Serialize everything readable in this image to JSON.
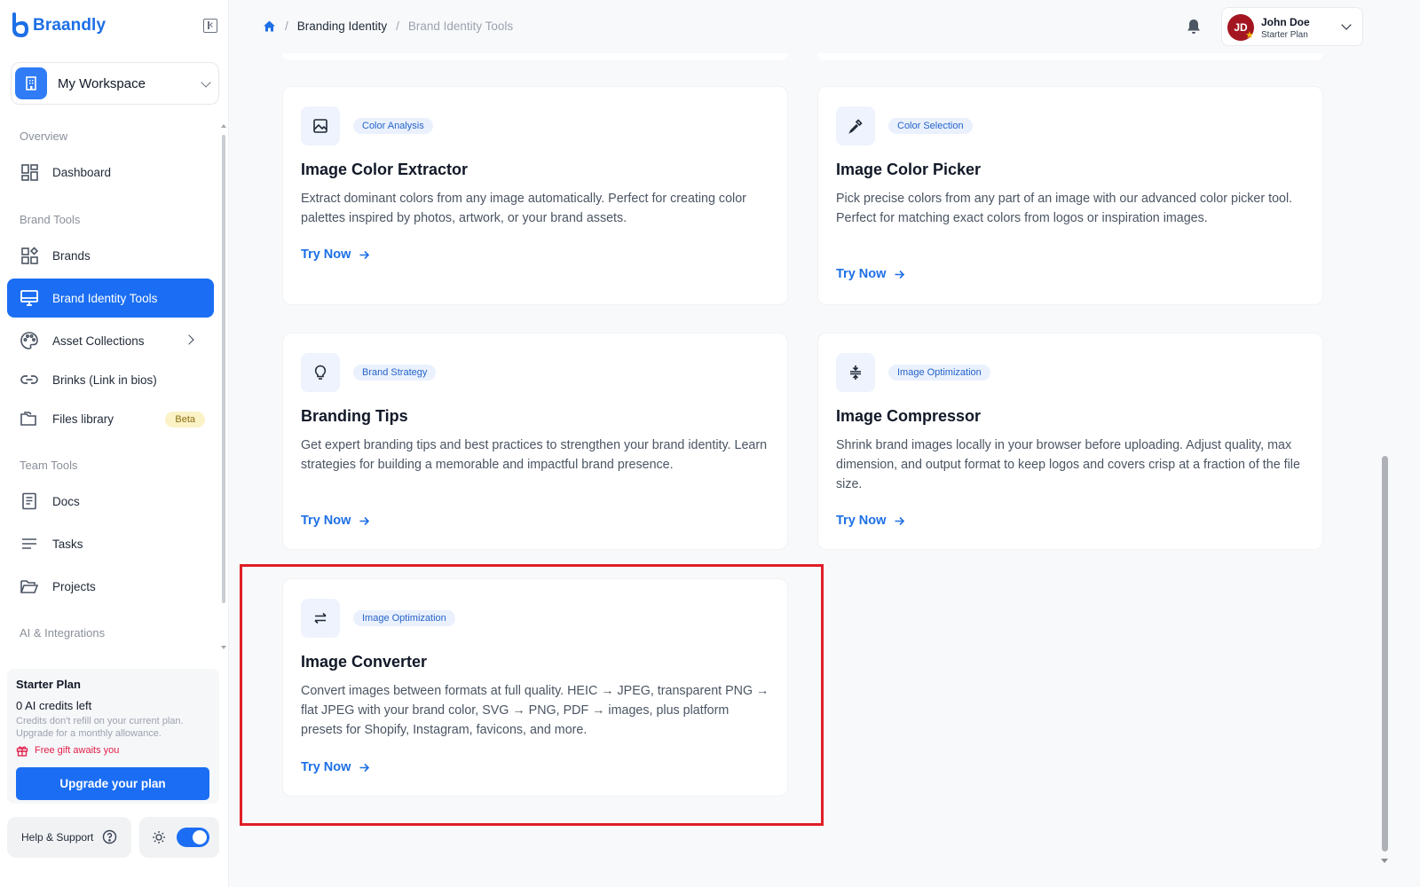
{
  "app": {
    "name": "Braandly"
  },
  "workspace": {
    "label": "My Workspace"
  },
  "sidebar": {
    "sections": [
      {
        "title": "Overview"
      },
      {
        "title": "Brand Tools"
      },
      {
        "title": "Team Tools"
      },
      {
        "title": "AI & Integrations"
      }
    ],
    "items": [
      {
        "label": "Dashboard",
        "icon": "dashboard-icon"
      },
      {
        "label": "Brands",
        "icon": "brands-icon"
      },
      {
        "label": "Brand Identity Tools",
        "icon": "monitor-icon",
        "active": true
      },
      {
        "label": "Asset Collections",
        "icon": "palette-icon"
      },
      {
        "label": "Brinks (Link in bios)",
        "icon": "link-icon"
      },
      {
        "label": "Files library",
        "icon": "folder-icon",
        "badge": "Beta"
      },
      {
        "label": "Docs",
        "icon": "document-icon"
      },
      {
        "label": "Tasks",
        "icon": "tasks-icon"
      },
      {
        "label": "Projects",
        "icon": "folder-open-icon"
      }
    ]
  },
  "plan": {
    "name": "Starter Plan",
    "credits": "0 AI credits left",
    "note": "Credits don't refill on your current plan. Upgrade for a monthly allowance.",
    "gift": "Free gift awaits you",
    "upgrade_label": "Upgrade your plan"
  },
  "footer": {
    "help_label": "Help & Support",
    "theme_toggle_on": true
  },
  "breadcrumb": {
    "items": [
      "Branding Identity",
      "Brand Identity Tools"
    ]
  },
  "user": {
    "initials": "JD",
    "name": "John Doe",
    "plan": "Starter Plan"
  },
  "cards": [
    {
      "badge": "Color Analysis",
      "title": "Image Color Extractor",
      "description": "Extract dominant colors from any image automatically. Perfect for creating color palettes inspired by photos, artwork, or your brand assets.",
      "link": "Try Now",
      "icon": "image-icon"
    },
    {
      "badge": "Color Selection",
      "title": "Image Color Picker",
      "description": "Pick precise colors from any part of an image with our advanced color picker tool. Perfect for matching exact colors from logos or inspiration images.",
      "link": "Try Now",
      "icon": "eyedropper-icon"
    },
    {
      "badge": "Brand Strategy",
      "title": "Branding Tips",
      "description": "Get expert branding tips and best practices to strengthen your brand identity. Learn strategies for building a memorable and impactful brand presence.",
      "link": "Try Now",
      "icon": "lightbulb-icon"
    },
    {
      "badge": "Image Optimization",
      "title": "Image Compressor",
      "description": "Shrink brand images locally in your browser before uploading. Adjust quality, max dimension, and output format to keep logos and covers crisp at a fraction of the file size.",
      "link": "Try Now",
      "icon": "compress-icon"
    },
    {
      "badge": "Image Optimization",
      "title": "Image Converter",
      "description": "Convert images between formats at full quality. HEIC → JPEG, transparent PNG → flat JPEG with your brand color, SVG → PNG, PDF → images, plus platform presets for Shopify, Instagram, favicons, and more.",
      "link": "Try Now",
      "icon": "swap-arrows-icon"
    }
  ],
  "colors": {
    "accent": "#1b6ef3",
    "highlight_border": "#e01e26",
    "badge_bg": "#eaf1fd",
    "beta_bg": "#fbf3c7"
  }
}
